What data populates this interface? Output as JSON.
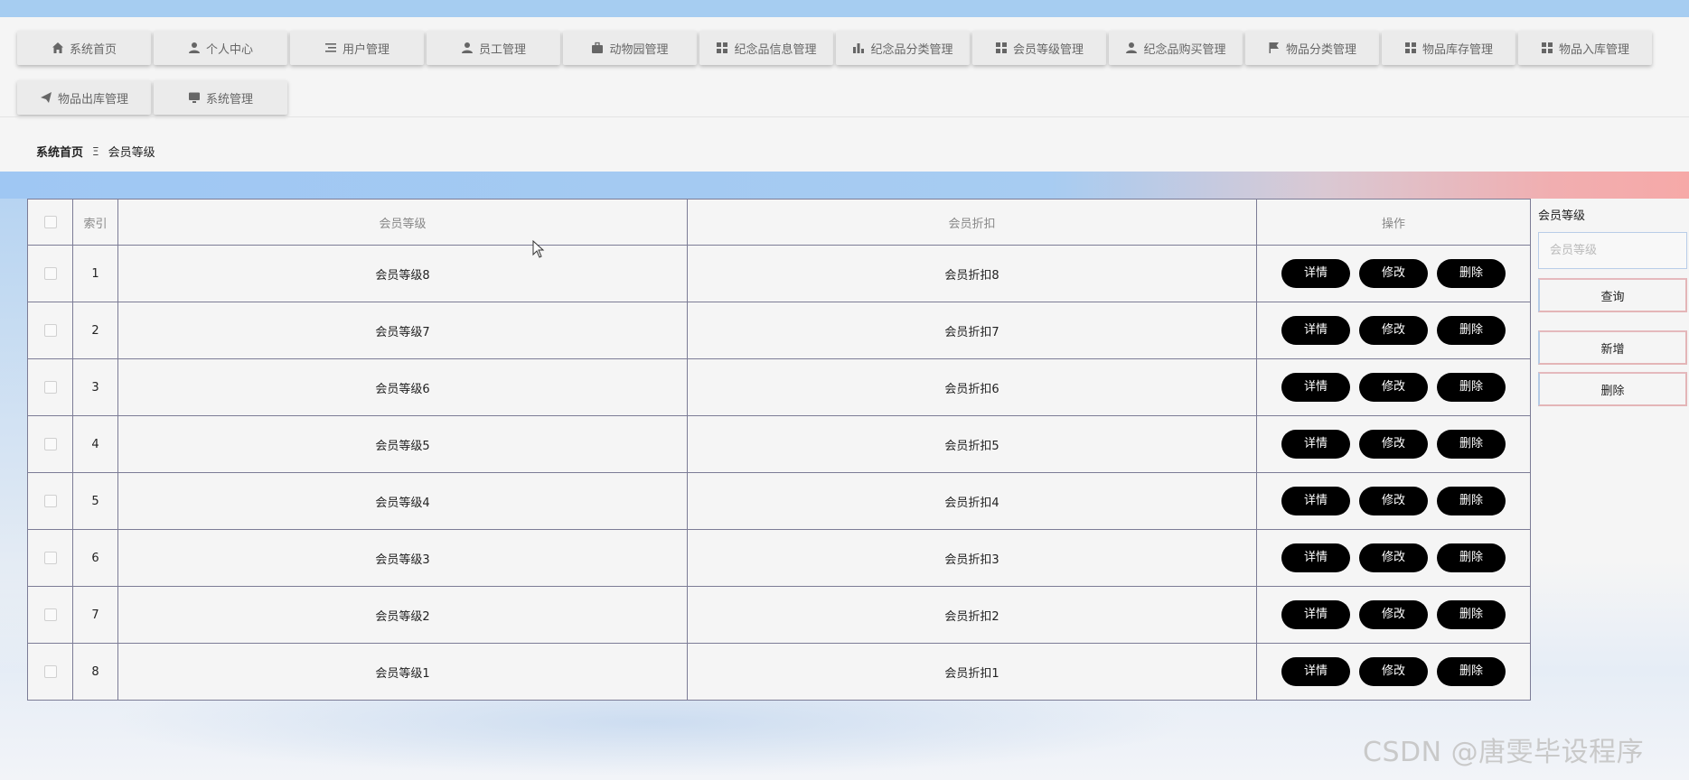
{
  "nav": {
    "items": [
      {
        "label": "系统首页",
        "icon": "home-icon"
      },
      {
        "label": "个人中心",
        "icon": "user-icon"
      },
      {
        "label": "用户管理",
        "icon": "list-icon"
      },
      {
        "label": "员工管理",
        "icon": "user-icon"
      },
      {
        "label": "动物园管理",
        "icon": "briefcase-icon"
      },
      {
        "label": "纪念品信息管理",
        "icon": "grid-icon"
      },
      {
        "label": "纪念品分类管理",
        "icon": "bar-chart-icon"
      },
      {
        "label": "会员等级管理",
        "icon": "grid-icon"
      },
      {
        "label": "纪念品购买管理",
        "icon": "user-icon"
      },
      {
        "label": "物品分类管理",
        "icon": "flag-icon"
      },
      {
        "label": "物品库存管理",
        "icon": "grid-icon"
      },
      {
        "label": "物品入库管理",
        "icon": "grid-icon"
      },
      {
        "label": "物品出库管理",
        "icon": "send-icon"
      },
      {
        "label": "系统管理",
        "icon": "monitor-icon"
      }
    ]
  },
  "breadcrumb": {
    "home": "系统首页",
    "separator": "Ξ",
    "current": "会员等级"
  },
  "table": {
    "headers": {
      "index": "索引",
      "level": "会员等级",
      "discount": "会员折扣",
      "actions": "操作"
    },
    "action_labels": {
      "detail": "详情",
      "edit": "修改",
      "delete": "删除"
    },
    "rows": [
      {
        "index": "1",
        "level": "会员等级8",
        "discount": "会员折扣8"
      },
      {
        "index": "2",
        "level": "会员等级7",
        "discount": "会员折扣7"
      },
      {
        "index": "3",
        "level": "会员等级6",
        "discount": "会员折扣6"
      },
      {
        "index": "4",
        "level": "会员等级5",
        "discount": "会员折扣5"
      },
      {
        "index": "5",
        "level": "会员等级4",
        "discount": "会员折扣4"
      },
      {
        "index": "6",
        "level": "会员等级3",
        "discount": "会员折扣3"
      },
      {
        "index": "7",
        "level": "会员等级2",
        "discount": "会员折扣2"
      },
      {
        "index": "8",
        "level": "会员等级1",
        "discount": "会员折扣1"
      }
    ]
  },
  "search": {
    "label": "会员等级",
    "placeholder": "会员等级",
    "value": ""
  },
  "side_buttons": {
    "query": "查询",
    "add": "新增",
    "delete": "删除"
  },
  "watermark": "CSDN @唐雯毕设程序",
  "colors": {
    "topbar": "#a6cdf1",
    "action_button": "#000000",
    "nav_button": "#ebebeb",
    "grid_line": "#7c7c96"
  }
}
